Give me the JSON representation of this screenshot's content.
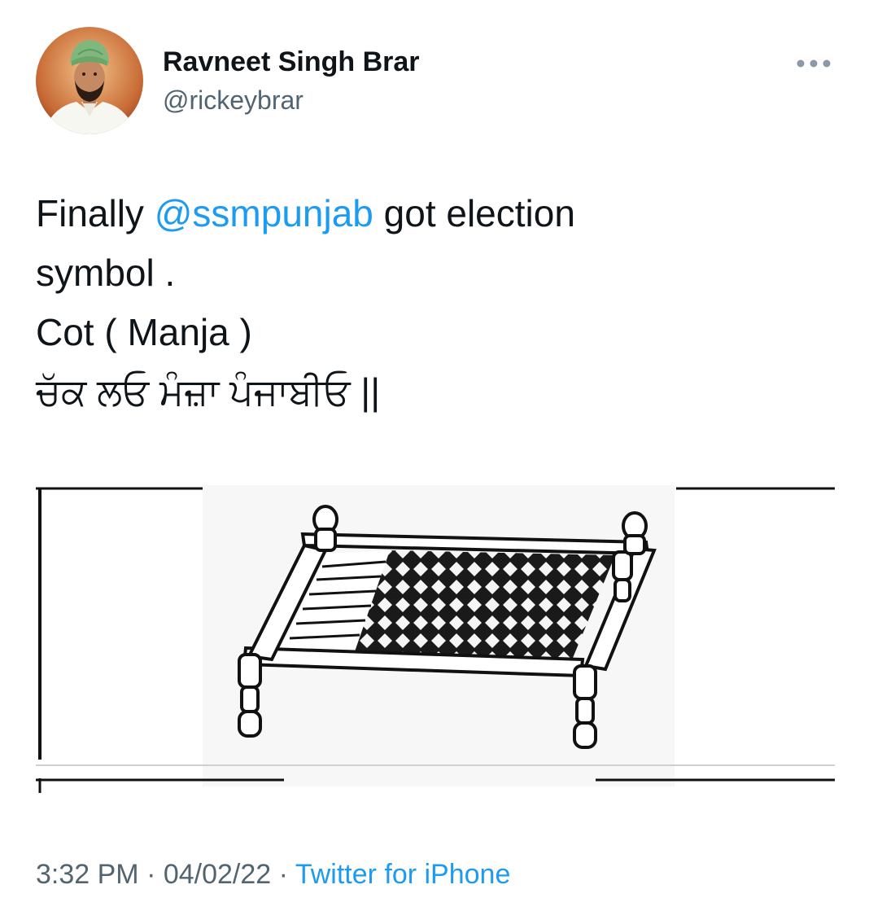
{
  "author": {
    "display_name": "Ravneet Singh Brar",
    "handle": "@rickeybrar",
    "avatar_icon": "profile-photo"
  },
  "more_icon": "more-horizontal-icon",
  "tweet": {
    "line1_pre": "Finally ",
    "line1_mention": "@ssmpunjab",
    "line1_post": " got election",
    "line2": "symbol .",
    "line3": "Cot ( Manja )",
    "line4": "ਚੱਕ ਲਓ ਮੰਜ਼ਾ ਪੰਜਾਬੀਓ ||"
  },
  "media": {
    "icon": "cot-election-symbol-image"
  },
  "meta": {
    "time": "3:32 PM",
    "sep1": " · ",
    "date": "04/02/22",
    "sep2": " · ",
    "source": "Twitter for iPhone"
  },
  "colors": {
    "link": "#1d9bf0",
    "secondary_text": "#536471",
    "primary_text": "#0f1419",
    "turban": "#7fb77e"
  }
}
